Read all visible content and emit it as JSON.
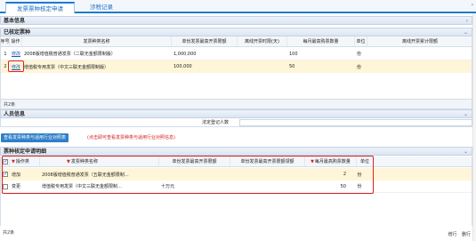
{
  "tabs": [
    "发票票种核定申请",
    "涉税记录"
  ],
  "sections": {
    "basic": "基本信息",
    "approved": "已核定票种",
    "taxpayer": "人员信息",
    "apply": "票种核定申请明细"
  },
  "approved_table": {
    "headers": [
      "序号",
      "操作",
      "发票种类名称",
      "单份发票最高开票限额",
      "离线开票时限(天)",
      "每月最高购票数量",
      "单位",
      "离线开票累计限额"
    ],
    "rows": [
      {
        "index": "1",
        "action": "修改",
        "name": "2008版增值税普通发票（二联无金额限制版）",
        "limit": "1,000,000",
        "offline_days": "",
        "monthly_max": "100",
        "unit": "份",
        "offline_total": ""
      },
      {
        "index": "2",
        "action": "修改",
        "name": "增值税专用发票（中文三联无金额限制版）",
        "limit": "100,000",
        "offline_days": "",
        "monthly_max": "50",
        "unit": "份",
        "offline_total": ""
      }
    ],
    "total": "共2条"
  },
  "taxpayer": {
    "label": "法定登记人数"
  },
  "query_button": "查看发票种类与适用行业对照表",
  "query_note": "(点击即可查看发票种类与适用行业对照信息)",
  "apply_table": {
    "headers": [
      "操作类",
      "发票种类名称",
      "单份发票最高开票限额",
      "单份发票最高开票限额领额",
      "每月最高购票数量",
      "单位"
    ],
    "rows": [
      {
        "checked": true,
        "op": "增加",
        "name": "2008版增值税普通发票（五联无金额限制…",
        "limit": "",
        "limit2": "",
        "monthly_max": "2",
        "unit": "份"
      },
      {
        "checked": false,
        "op": "变更",
        "name": "增值税专用发票（中文三联无金额限制…",
        "limit": "十万元",
        "limit2": "",
        "monthly_max": "50",
        "unit": "份"
      }
    ],
    "total": "共2条"
  },
  "bottom_actions": [
    "增行",
    "删行"
  ],
  "colors": {
    "accent": "#1c7bd2",
    "highlight": "#e02020",
    "selected_row": "#fff6d9"
  }
}
